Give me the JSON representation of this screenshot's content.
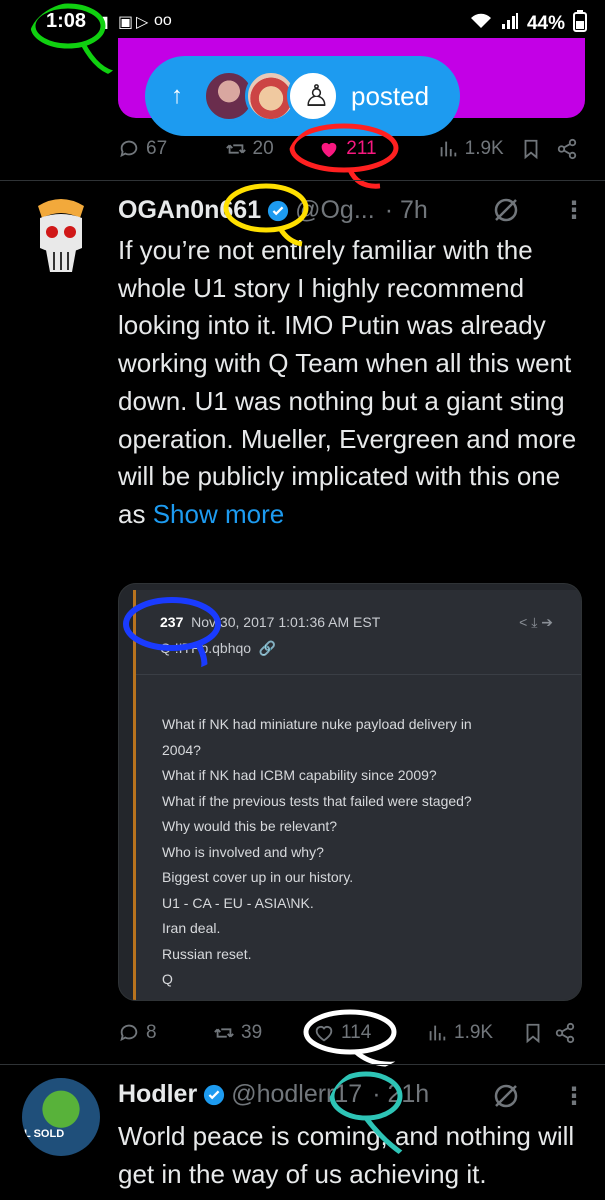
{
  "status_bar": {
    "time": "1:08",
    "battery": "44%"
  },
  "new_posts_pill": {
    "label": "posted",
    "arrow": "↑"
  },
  "tweet1": {
    "replies": "67",
    "reposts": "20",
    "likes": "211",
    "views": "1.9K"
  },
  "tweet2": {
    "name": "OGAn0n661",
    "handle": "@Og...",
    "time": "· 7h",
    "body": "If you’re not entirely familiar with the whole U1 story I highly recommend looking into it. IMO Putin was already working with Q Team when all this went down. U1 was nothing but a giant sting operation. Mueller, Evergreen and more will be publicly implicated with this one as ",
    "show_more": "Show more",
    "card": {
      "post_number": "237",
      "date": "Nov 30, 2017 1:01:36 AM EST",
      "trip": "Q !ITPb.qbhqo",
      "lines": [
        "What if NK had miniature nuke payload delivery in",
        "2004?",
        "What if NK had ICBM capability since 2009?",
        "What if the previous tests that failed were staged?",
        "Why would this be relevant?",
        "Who is involved and why?",
        "Biggest cover up in our history.",
        "U1 - CA - EU - ASIA\\NK.",
        "Iran deal.",
        "Russian reset.",
        "Q"
      ]
    },
    "replies": "8",
    "reposts": "39",
    "likes": "114",
    "views": "1.9K"
  },
  "tweet3": {
    "name": "Hodler",
    "handle": "@hodlerr17",
    "time": "· 21h",
    "body": "World peace is coming, and nothing will get in the way of us achieving it.",
    "avatar_caption": "L SOLD"
  },
  "colors": {
    "accent": "#1d9bf0",
    "like_pink": "#f91880",
    "media_magenta": "#c300e6"
  }
}
